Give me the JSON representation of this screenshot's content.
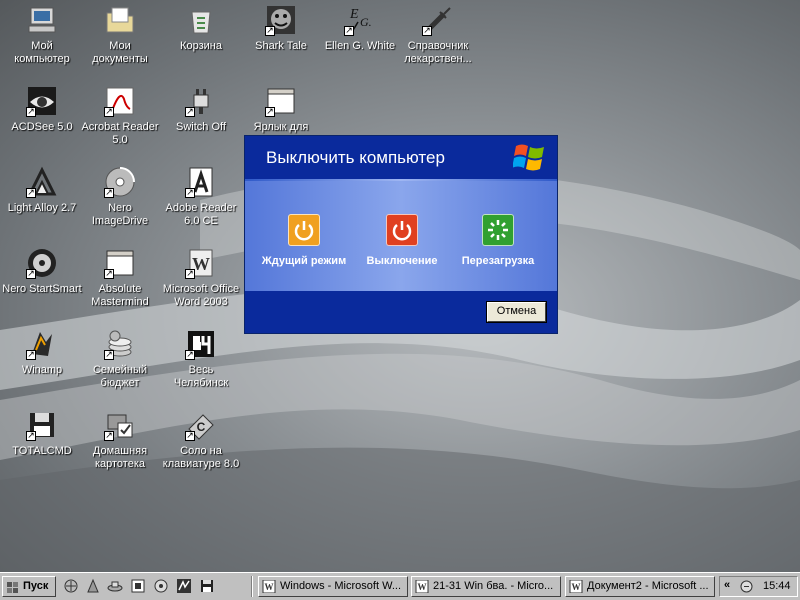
{
  "desktop_icons": [
    {
      "label": "Мой компьютер",
      "icon": "my-computer-icon"
    },
    {
      "label": "Мои документы",
      "icon": "my-documents-icon"
    },
    {
      "label": "Корзина",
      "icon": "recycle-bin-icon"
    },
    {
      "label": "Shark Tale",
      "icon": "shark-tale-icon"
    },
    {
      "label": "Ellen G. White",
      "icon": "ellen-white-icon"
    },
    {
      "label": "Справочник лекарствен...",
      "icon": "syringe-icon"
    },
    {
      "label": "ACDSee 5.0",
      "icon": "acdsee-eye-icon"
    },
    {
      "label": "Acrobat Reader 5.0",
      "icon": "acrobat-icon"
    },
    {
      "label": "Switch Off",
      "icon": "plug-icon"
    },
    {
      "label": "Ярлык для",
      "icon": "window-shortcut-icon"
    },
    {
      "label": "Light Alloy 2.7",
      "icon": "light-alloy-icon"
    },
    {
      "label": "Nero ImageDrive",
      "icon": "nero-disc-icon"
    },
    {
      "label": "Adobe Reader 6.0 CE",
      "icon": "adobe-reader-icon"
    },
    {
      "label": "Nero StartSmart",
      "icon": "nero-startsmart-icon"
    },
    {
      "label": "Absolute Mastermind",
      "icon": "window-app-icon"
    },
    {
      "label": "Microsoft Office Word 2003",
      "icon": "word-icon"
    },
    {
      "label": "Winamp",
      "icon": "winamp-icon"
    },
    {
      "label": "Семейный бюджет",
      "icon": "coins-icon"
    },
    {
      "label": "Весь Челябинск",
      "icon": "ves-chelyabinsk-icon"
    },
    {
      "label": "TOTALCMD",
      "icon": "floppy-icon"
    },
    {
      "label": "Домашняя картотека",
      "icon": "card-index-icon"
    },
    {
      "label": "Соло на клавиатуре 8.0",
      "icon": "keyboard-solo-icon"
    }
  ],
  "dialog": {
    "title": "Выключить компьютер",
    "options": [
      {
        "label": "Ждущий режим",
        "icon": "standby-icon",
        "color": "#f0a020"
      },
      {
        "label": "Выключение",
        "icon": "power-off-icon",
        "color": "#e04020"
      },
      {
        "label": "Перезагрузка",
        "icon": "restart-icon",
        "color": "#30a030"
      }
    ],
    "cancel_label": "Отмена"
  },
  "taskbar": {
    "start_label": "Пуск",
    "quick_launch": [
      "desktop-icon",
      "internet-icon",
      "network-icon",
      "media-icon",
      "browser-icon",
      "winamp-icon",
      "floppy-icon"
    ],
    "tasks": [
      {
        "label": "Windows - Microsoft W...",
        "icon": "word-doc-icon"
      },
      {
        "label": "21-31  Win бва. - Micro...",
        "icon": "word-doc-icon"
      },
      {
        "label": "Документ2 - Microsoft ...",
        "icon": "word-doc-icon"
      }
    ],
    "tray": {
      "chevron": "«",
      "clock": "15:44"
    }
  },
  "colors": {
    "dialog_header": "#0a2a9c",
    "dialog_body": "#5a7edc",
    "taskbar": "#c0c0c0"
  }
}
